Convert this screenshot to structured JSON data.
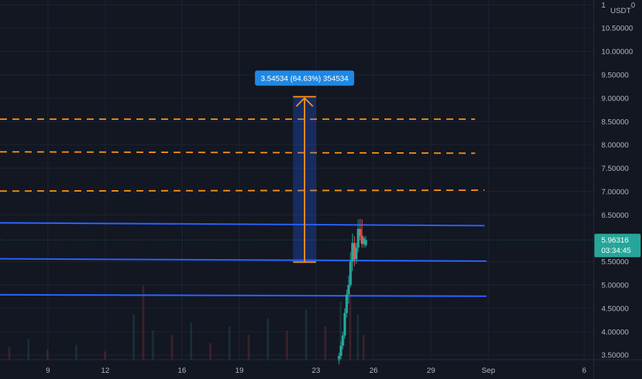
{
  "chart_data": {
    "type": "candlestick",
    "currency_label": "USDT",
    "y_axis": {
      "range": [
        3.4,
        11.1
      ],
      "ticks": [
        {
          "value": 11.0,
          "label": "1"
        },
        {
          "value": 10.5,
          "label": "10.50000"
        },
        {
          "value": 10.0,
          "label": "10.00000"
        },
        {
          "value": 9.5,
          "label": "9.50000"
        },
        {
          "value": 9.0,
          "label": "9.00000"
        },
        {
          "value": 8.5,
          "label": "8.50000"
        },
        {
          "value": 8.0,
          "label": "8.00000"
        },
        {
          "value": 7.5,
          "label": "7.50000"
        },
        {
          "value": 7.0,
          "label": "7.00000"
        },
        {
          "value": 6.5,
          "label": "6.50000"
        },
        {
          "value": 5.5,
          "label": "5.50000"
        },
        {
          "value": 5.0,
          "label": "5.00000"
        },
        {
          "value": 4.5,
          "label": "4.50000"
        },
        {
          "value": 4.0,
          "label": "4.00000"
        },
        {
          "value": 3.5,
          "label": "3.50000"
        }
      ],
      "right_edge_label": "0"
    },
    "x_axis": {
      "range_days": [
        6.5,
        37.5
      ],
      "ticks": [
        {
          "day": 9,
          "label": "9"
        },
        {
          "day": 12,
          "label": "12"
        },
        {
          "day": 16,
          "label": "16"
        },
        {
          "day": 19,
          "label": "19"
        },
        {
          "day": 23,
          "label": "23"
        },
        {
          "day": 26,
          "label": "26"
        },
        {
          "day": 29,
          "label": "29"
        },
        {
          "day": 32,
          "label": "Sep"
        },
        {
          "day": 37,
          "label": "6"
        }
      ]
    },
    "current_price": {
      "value": 5.96316,
      "label": "5.96316",
      "countdown": "03:34:45",
      "color": "#26a69a"
    },
    "measure": {
      "label": "3.54534 (64.63%) 354534",
      "from_price": 5.49,
      "to_price": 9.03,
      "day_start": 21.8,
      "day_end": 23.0,
      "color": "#f7931a"
    },
    "horizontal_lines": [
      {
        "style": "dashed",
        "color": "#f7931a",
        "day_start": 6.5,
        "day_end": 31.3,
        "price_start": 8.55,
        "price_end": 8.55
      },
      {
        "style": "dashed",
        "color": "#f7931a",
        "day_start": 6.5,
        "day_end": 31.3,
        "price_start": 7.85,
        "price_end": 7.82
      },
      {
        "style": "dashed",
        "color": "#f7931a",
        "day_start": 6.5,
        "day_end": 31.8,
        "price_start": 7.01,
        "price_end": 7.03
      },
      {
        "style": "solid",
        "color": "#2962ff",
        "day_start": 6.5,
        "day_end": 31.8,
        "price_start": 6.33,
        "price_end": 6.27
      },
      {
        "style": "solid",
        "color": "#2962ff",
        "day_start": 6.5,
        "day_end": 31.9,
        "price_start": 5.56,
        "price_end": 5.51
      },
      {
        "style": "solid",
        "color": "#2962ff",
        "day_start": 6.5,
        "day_end": 31.9,
        "price_start": 4.79,
        "price_end": 4.76
      }
    ],
    "candles": [
      {
        "day": 24.2,
        "o": 3.38,
        "h": 3.55,
        "l": 3.3,
        "c": 3.48
      },
      {
        "day": 24.3,
        "o": 3.48,
        "h": 3.8,
        "l": 3.4,
        "c": 3.7
      },
      {
        "day": 24.4,
        "o": 3.7,
        "h": 4.0,
        "l": 3.62,
        "c": 3.92
      },
      {
        "day": 24.5,
        "o": 3.92,
        "h": 4.5,
        "l": 3.85,
        "c": 4.4
      },
      {
        "day": 24.6,
        "o": 4.4,
        "h": 4.9,
        "l": 4.3,
        "c": 4.8
      },
      {
        "day": 24.7,
        "o": 4.8,
        "h": 5.2,
        "l": 4.6,
        "c": 5.0
      },
      {
        "day": 24.8,
        "o": 5.0,
        "h": 5.7,
        "l": 4.95,
        "c": 5.5
      },
      {
        "day": 24.9,
        "o": 5.5,
        "h": 6.1,
        "l": 5.3,
        "c": 5.9
      },
      {
        "day": 25.0,
        "o": 5.9,
        "h": 6.05,
        "l": 5.4,
        "c": 5.55
      },
      {
        "day": 25.1,
        "o": 5.55,
        "h": 5.9,
        "l": 5.45,
        "c": 5.8
      },
      {
        "day": 25.2,
        "o": 5.8,
        "h": 6.4,
        "l": 5.7,
        "c": 6.2
      },
      {
        "day": 25.3,
        "o": 6.2,
        "h": 6.42,
        "l": 5.95,
        "c": 6.05
      },
      {
        "day": 25.4,
        "o": 6.05,
        "h": 6.4,
        "l": 5.8,
        "c": 5.88
      },
      {
        "day": 25.5,
        "o": 5.88,
        "h": 6.05,
        "l": 5.8,
        "c": 6.0
      },
      {
        "day": 25.6,
        "o": 5.85,
        "h": 6.05,
        "l": 5.8,
        "c": 5.96
      }
    ],
    "volume": [
      {
        "day": 7.0,
        "v": 0.15
      },
      {
        "day": 8.0,
        "v": 0.25
      },
      {
        "day": 9.0,
        "v": 0.12
      },
      {
        "day": 10.5,
        "v": 0.18
      },
      {
        "day": 12.0,
        "v": 0.1
      },
      {
        "day": 13.5,
        "v": 0.55
      },
      {
        "day": 14.0,
        "v": 0.9
      },
      {
        "day": 14.5,
        "v": 0.35
      },
      {
        "day": 15.5,
        "v": 0.3
      },
      {
        "day": 16.5,
        "v": 0.45
      },
      {
        "day": 17.5,
        "v": 0.2
      },
      {
        "day": 18.5,
        "v": 0.4
      },
      {
        "day": 19.5,
        "v": 0.3
      },
      {
        "day": 20.5,
        "v": 0.5
      },
      {
        "day": 21.5,
        "v": 0.35
      },
      {
        "day": 22.5,
        "v": 0.6
      },
      {
        "day": 23.5,
        "v": 0.4
      },
      {
        "day": 24.3,
        "v": 0.7
      },
      {
        "day": 24.8,
        "v": 0.8
      },
      {
        "day": 25.2,
        "v": 0.55
      },
      {
        "day": 25.5,
        "v": 0.3
      }
    ],
    "colors": {
      "background": "#131722",
      "grid": "#1f2433",
      "up": "#26a69a",
      "down": "#ef5350",
      "axis_text": "#b2b5be",
      "measure_fill": "#2962ff",
      "label_bg": "#1e88e5"
    }
  }
}
